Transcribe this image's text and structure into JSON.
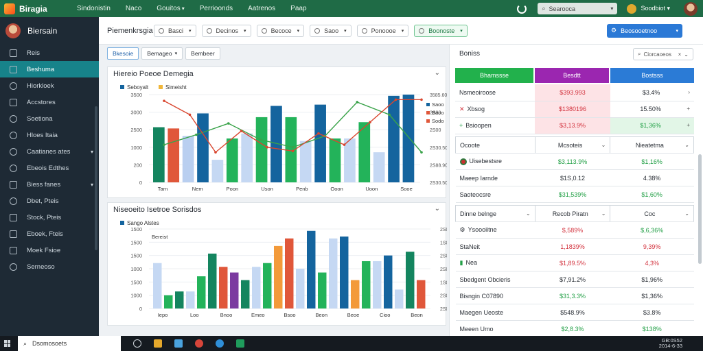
{
  "app": {
    "brand": "Biragia"
  },
  "topnav": [
    {
      "label": "Sindonistin",
      "dropdown": false
    },
    {
      "label": "Naco",
      "dropdown": false
    },
    {
      "label": "Gouitos",
      "dropdown": true
    },
    {
      "label": "Perrioonds",
      "dropdown": false
    },
    {
      "label": "Aatrenos",
      "dropdown": false
    },
    {
      "label": "Paap",
      "dropdown": false
    }
  ],
  "topbar": {
    "search_label": "Searooca",
    "user_name": "Soodbiot"
  },
  "sidebar": {
    "user": "Biersain",
    "items": [
      {
        "label": "Reis",
        "icon": "square-icon",
        "active": false,
        "dropdown": false
      },
      {
        "label": "Beshuma",
        "icon": "runner-icon",
        "active": true,
        "dropdown": false
      },
      {
        "label": "Hiorkloek",
        "icon": "clock-icon",
        "active": false,
        "dropdown": false
      },
      {
        "label": "Accstores",
        "icon": "box-icon",
        "active": false,
        "dropdown": false
      },
      {
        "label": "Soetiona",
        "icon": "gear-icon",
        "active": false,
        "dropdown": false
      },
      {
        "label": "Hloes Itaia",
        "icon": "refresh-icon",
        "active": false,
        "dropdown": false
      },
      {
        "label": "Caatianes ates",
        "icon": "compass-icon",
        "active": false,
        "dropdown": true
      },
      {
        "label": "Ebeois Edthes",
        "icon": "clock-icon",
        "active": false,
        "dropdown": false
      },
      {
        "label": "Biess fanes",
        "icon": "grid-icon",
        "active": false,
        "dropdown": true
      },
      {
        "label": "Dbet, Pteis",
        "icon": "chat-icon",
        "active": false,
        "dropdown": false
      },
      {
        "label": "Stock, Pteis",
        "icon": "doc-icon",
        "active": false,
        "dropdown": false
      },
      {
        "label": "Eboek, Fteis",
        "icon": "doc-icon",
        "active": false,
        "dropdown": false
      },
      {
        "label": "Moek Fsioe",
        "icon": "doc-icon",
        "active": false,
        "dropdown": false
      },
      {
        "label": "Serneoso",
        "icon": "gear-icon",
        "active": false,
        "dropdown": false
      }
    ]
  },
  "toolbar": {
    "title": "Piemenkrsgia",
    "buttons": [
      "Basci",
      "Decinos",
      "Becoce",
      "Saoo",
      "Ponoooe",
      "Boonoste"
    ],
    "primary": "Beosooetnoo"
  },
  "subtabs": [
    "Bkesoie",
    "Bemageo",
    "Bembeer"
  ],
  "chart1": {
    "title": "Hiereio Poeoe Demegia"
  },
  "chart2": {
    "title": "Niseoeito Isetroe Sorisdos"
  },
  "chart_data": [
    {
      "type": "bar",
      "title": "Hiereio Poeoe Demegia",
      "legend": [
        "Seboyalt",
        "Simeisht"
      ],
      "legend_right": [
        "Saoo",
        "Baoo",
        "Sodo"
      ],
      "yticks_left": [
        "3500",
        "3000",
        "2500",
        "1000",
        "200",
        "0"
      ],
      "yticks_right": [
        "3585.60",
        "2S00",
        "2S00",
        "2S30.50",
        "2S88.90",
        "2S30.50"
      ],
      "categories": [
        "Tarn",
        "Nem",
        "Poon",
        "Uson",
        "Penb",
        "Ooon",
        "Uoon",
        "Sooe"
      ],
      "series": [
        {
          "name": "Seboyalt",
          "color": "#14649e",
          "values": [
            0,
            2750,
            0,
            0,
            3050,
            0,
            3100,
            0,
            1750,
            0,
            3500
          ]
        },
        {
          "name": "Simeisht",
          "color": "#f0b63a",
          "values": [
            0,
            0,
            0,
            0,
            0,
            0,
            0,
            0,
            0,
            0,
            0
          ]
        }
      ],
      "bars": [
        {
          "value": 2200,
          "color": "#14855f"
        },
        {
          "value": 2150,
          "color": "#e0573a"
        },
        {
          "value": 1850,
          "color": "#b9cff0"
        },
        {
          "value": 2750,
          "color": "#14649e"
        },
        {
          "value": 900,
          "color": "#c5d8f3"
        },
        {
          "value": 1750,
          "color": "#23b35a"
        },
        {
          "value": 1950,
          "color": "#c5d8f3"
        },
        {
          "value": 2600,
          "color": "#23b35a"
        },
        {
          "value": 3050,
          "color": "#14649e"
        },
        {
          "value": 2600,
          "color": "#23b35a"
        },
        {
          "value": 1650,
          "color": "#c5d8f3"
        },
        {
          "value": 3100,
          "color": "#14649e"
        },
        {
          "value": 1750,
          "color": "#23b35a"
        },
        {
          "value": 1750,
          "color": "#c5d8f3"
        },
        {
          "value": 2400,
          "color": "#23b35a"
        },
        {
          "value": 1200,
          "color": "#c5d8f3"
        },
        {
          "value": 3450,
          "color": "#14649e"
        },
        {
          "value": 3500,
          "color": "#14649e"
        }
      ],
      "line_green": [
        1500,
        1900,
        2350,
        1700,
        1400,
        1850,
        3200,
        2700,
        1200
      ],
      "line_red": [
        3250,
        2700,
        1200,
        2050,
        1400,
        1250,
        1950,
        1500,
        2400,
        3300,
        3300
      ]
    },
    {
      "type": "bar",
      "title": "Niseoeito Isetroe Sorisdos",
      "legend": [
        "Sango Alstes"
      ],
      "yticks_left": [
        "1500",
        "1500",
        "1500",
        "1000",
        "1500",
        "1000",
        "0"
      ],
      "yticks_right": [
        "2S00",
        "1S00",
        "2S00",
        "2S00",
        "1S00",
        "2S00",
        "2S00"
      ],
      "inner_label": "Bereist",
      "categories": [
        "Iepo",
        "Loo",
        "Bnoo",
        "Emeo",
        "Bsoo",
        "Beon",
        "Beoe",
        "Cioo",
        "Beon"
      ],
      "bars": [
        {
          "value": 1200,
          "color": "#c5d8f3"
        },
        {
          "value": 350,
          "color": "#23b35a"
        },
        {
          "value": 450,
          "color": "#14855f"
        },
        {
          "value": 450,
          "color": "#c5d8f3"
        },
        {
          "value": 850,
          "color": "#23b35a"
        },
        {
          "value": 1450,
          "color": "#14855f"
        },
        {
          "value": 1100,
          "color": "#e0573a"
        },
        {
          "value": 950,
          "color": "#7b3aa0"
        },
        {
          "value": 750,
          "color": "#14855f"
        },
        {
          "value": 1100,
          "color": "#c5d8f3"
        },
        {
          "value": 1200,
          "color": "#23b35a"
        },
        {
          "value": 1650,
          "color": "#f39a3a"
        },
        {
          "value": 1850,
          "color": "#e0573a"
        },
        {
          "value": 1050,
          "color": "#c5d8f3"
        },
        {
          "value": 2050,
          "color": "#14649e"
        },
        {
          "value": 950,
          "color": "#23b35a"
        },
        {
          "value": 1850,
          "color": "#c5d8f3"
        },
        {
          "value": 1900,
          "color": "#14649e"
        },
        {
          "value": 750,
          "color": "#f39a3a"
        },
        {
          "value": 1250,
          "color": "#23b35a"
        },
        {
          "value": 1250,
          "color": "#c5d8f3"
        },
        {
          "value": 1400,
          "color": "#14649e"
        },
        {
          "value": 500,
          "color": "#c5d8f3"
        },
        {
          "value": 1500,
          "color": "#14855f"
        },
        {
          "value": 750,
          "color": "#e0573a"
        }
      ]
    }
  ],
  "rpanel": {
    "title": "Boniss",
    "search": "Ciorcaoeos",
    "headers": [
      {
        "label": "Bhamssse",
        "color": "#22b14c"
      },
      {
        "label": "Besdtt",
        "color": "#9b26b0"
      },
      {
        "label": "Bostsss",
        "color": "#2b7bd6"
      }
    ],
    "group1": [
      {
        "name": "Nsmeoiroose",
        "v1": "$393.993",
        "v2": "$3.4%",
        "c1": "red",
        "c2": "dark",
        "arrow": "›",
        "bg1": "bgred",
        "bg2": ""
      },
      {
        "name": "Xbsog",
        "v1": "$1380196",
        "v2": "15.50%",
        "c1": "red",
        "c2": "dark",
        "arrow": "+",
        "bg1": "bgred",
        "bg2": "",
        "icon": "x"
      },
      {
        "name": "Bsioopen",
        "v1": "$3,13.9%",
        "v2": "$1,36%",
        "c1": "red",
        "c2": "green",
        "arrow": "+",
        "bg1": "bgred",
        "bg2": "bggreen",
        "icon": "plus"
      }
    ],
    "group2_head": [
      "Ocoote",
      "Mcsoteis",
      "Nieatetma"
    ],
    "group2": [
      {
        "name": "Uisebestsre",
        "v1": "$3,113.9%",
        "v2": "$1,16%",
        "c1": "green",
        "c2": "green",
        "icon": "flag"
      },
      {
        "name": "Maeep Iarnde",
        "v1": "$1S,0.12",
        "v2": "4.38%",
        "c1": "dark",
        "c2": "dark"
      },
      {
        "name": "Saoteocsre",
        "v1": "$31,539%",
        "v2": "$1,60%",
        "c1": "green",
        "c2": "green"
      }
    ],
    "group3_head": [
      "Dinne belnge",
      "Recob Piratn",
      "Coc"
    ],
    "group3": [
      {
        "name": "Ysoooiitne",
        "v1": "$,589%",
        "v2": "$,6,36%",
        "c1": "red",
        "c2": "green",
        "icon": "gear"
      },
      {
        "name": "StaNeit",
        "v1": "1,1839%",
        "v2": "9,39%",
        "c1": "red",
        "c2": "red"
      },
      {
        "name": "Nea",
        "v1": "$1,89.5%",
        "v2": "4,3%",
        "c1": "red",
        "c2": "red",
        "icon": "bar"
      },
      {
        "name": "Sbedgent Obcieris",
        "v1": "$7,91.2%",
        "v2": "$1,96%",
        "c1": "dark",
        "c2": "dark"
      },
      {
        "name": "Bisngin C07890",
        "v1": "$31,3.3%",
        "v2": "$1,36%",
        "c1": "green",
        "c2": "dark"
      },
      {
        "name": "Maegen Ueoste",
        "v1": "$548.9%",
        "v2": "$3.8%",
        "c1": "dark",
        "c2": "dark"
      },
      {
        "name": "Meeen Umo",
        "v1": "$2,8.3%",
        "v2": "$138%",
        "c1": "green",
        "c2": "green"
      }
    ]
  },
  "taskbar": {
    "search": "Dsomosoets",
    "clock_line1": "GB:0S52",
    "clock_line2": "2014-6-33"
  }
}
